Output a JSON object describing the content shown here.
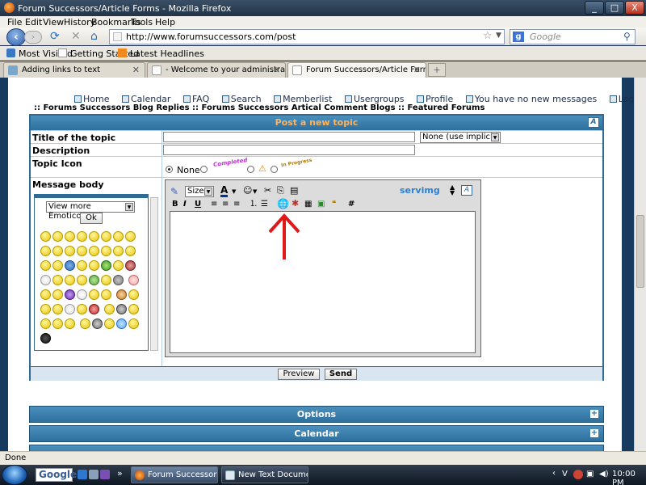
{
  "window": {
    "title": "Forum Successors/Article Forms - Mozilla Firefox",
    "controls": [
      "_",
      "□",
      "X"
    ]
  },
  "menu": [
    "File",
    "Edit",
    "View",
    "History",
    "Bookmarks",
    "Tools",
    "Help"
  ],
  "nav": {
    "url": "http://www.forumsuccessors.com/post",
    "search_placeholder": "Google"
  },
  "bookmarks": [
    "Most Visited",
    "Getting Started",
    "Latest Headlines"
  ],
  "tabs": [
    {
      "label": "Adding links to text",
      "active": false
    },
    {
      "label": "- Welcome to your administration p...",
      "active": false
    },
    {
      "label": "Forum Successors/Article Forms",
      "active": true
    }
  ],
  "page": {
    "top_links": [
      "Home",
      "Calendar",
      "FAQ",
      "Search",
      "Memberlist",
      "Usergroups",
      "Profile",
      "You have no new messages",
      "Log out [ Kirk ]"
    ],
    "sub_links": ":: Forums Successors Blog Replies :: Forums Successors Artical Comment Blogs :: Featured Forums",
    "post_header": "Post a new topic",
    "fields": {
      "title_label": "Title of the topic",
      "title_value": "",
      "type_select": "None (use implicit)",
      "description_label": "Description",
      "description_value": "",
      "icon_label": "Topic Icon",
      "icon_none": "None",
      "icon_completed": "Completed",
      "icon_inprogress": "In Progress",
      "message_label": "Message body"
    },
    "emoticons": {
      "more_select": "View more Emoticons",
      "ok_button": "Ok"
    },
    "editor": {
      "sizes_select": "Sizes",
      "servimg": "servimg",
      "bold": "B",
      "italic": "I",
      "underline": "U",
      "hash": "#",
      "body_text": ""
    },
    "buttons": {
      "preview": "Preview",
      "send": "Send"
    },
    "accordions": [
      "Options",
      "Calendar"
    ]
  },
  "status": "Done",
  "taskbar": {
    "search": "Google",
    "tasks": [
      {
        "label": "Forum Successors/...",
        "active": true
      },
      {
        "label": "New Text Documen...",
        "active": false
      }
    ],
    "clock": "10:00 PM"
  },
  "colors": {
    "header_blue": "#2e6f9d",
    "header_text": "#fdb35f",
    "arrow_red": "#e01818",
    "page_border": "#163b5e"
  }
}
